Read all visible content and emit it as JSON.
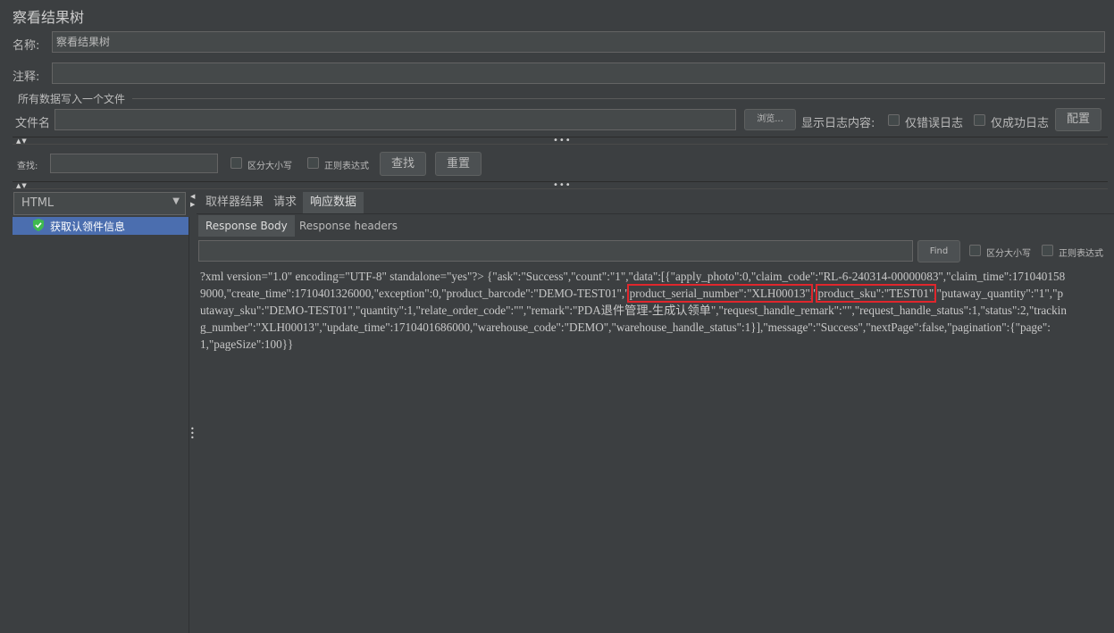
{
  "window": {
    "title": "察看结果树"
  },
  "form": {
    "name_label": "名称:",
    "name_value": "察看结果树",
    "comment_label": "注释:",
    "comment_value": "",
    "write_all_label": "所有数据写入一个文件",
    "filename_label": "文件名",
    "filename_value": "",
    "browse_label": "浏览...",
    "log_content_label": "显示日志内容:",
    "errors_only_label": "仅错误日志",
    "success_only_label": "仅成功日志",
    "config_label": "配置"
  },
  "search": {
    "label": "查找:",
    "value": "",
    "case_label": "区分大小写",
    "regex_label": "正则表达式",
    "find_label": "查找",
    "reset_label": "重置"
  },
  "renderer": {
    "selected": "HTML"
  },
  "tree": {
    "items": [
      {
        "label": "获取认领件信息",
        "status": "success"
      }
    ]
  },
  "tabs": {
    "sampler_result": "取样器结果",
    "request": "请求",
    "response_data": "响应数据",
    "active": "响应数据"
  },
  "subtabs": {
    "body": "Response Body",
    "headers": "Response headers",
    "active": "Response Body"
  },
  "body_search": {
    "value": "",
    "find_label": "Find",
    "case_label": "区分大小写",
    "regex_label": "正则表达式"
  },
  "response": {
    "part1": "?xml version=\"1.0\" encoding=\"UTF-8\" standalone=\"yes\"?>     {\"ask\":\"Success\",\"count\":\"1\",\"data\":[{\"apply_photo\":0,\"claim_code\":\"RL-6-240314-00000083\",\"claim_time\":1710401589000,\"create_time\":1710401326000,\"exception\":0,\"product_barcode\":\"DEMO-TEST01\",\"",
    "hl1": "product_serial_number\":\"XLH00013\"",
    "sep": ",\"",
    "hl2": "product_sku\":\"TEST01\"",
    "part2": ",\"putaway_quantity\":\"1\",\"putaway_sku\":\"DEMO-TEST01\",\"quantity\":1,\"relate_order_code\":\"\",\"remark\":\"PDA退件管理-生成认领单\",\"request_handle_remark\":\"\",\"request_handle_status\":1,\"status\":2,\"tracking_number\":\"XLH00013\",\"update_time\":1710401686000,\"warehouse_code\":\"DEMO\",\"warehouse_handle_status\":1}],\"message\":\"Success\",\"nextPage\":false,\"pagination\":{\"page\":1,\"pageSize\":100}}"
  },
  "colors": {
    "background": "#3c3f41",
    "selected_row": "#4b6eaf",
    "highlight_box": "#e0262c",
    "success_icon": "#3fb950"
  },
  "icons": {
    "success": "shield-check-icon",
    "dropdown": "chevron-down-icon",
    "split_handle": "grip-dots-icon",
    "collapse": "triangle-arrows-icon"
  }
}
